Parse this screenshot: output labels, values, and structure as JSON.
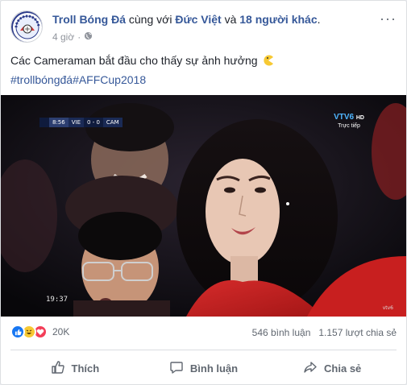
{
  "post": {
    "page_name": "Troll Bóng Đá",
    "with_text": " cùng với ",
    "tagged_person": "Đức Việt",
    "and_text": " và ",
    "others": "18 người khác",
    "period": ".",
    "time": "4 giờ",
    "dot": "·",
    "text": "Các Cameraman bắt đầu cho thấy sự ảnh hưởng",
    "hashtag1": "#trollbóngđá",
    "hashtag2": "#AFFCup2018",
    "more_label": "···"
  },
  "video": {
    "time_score": "8:56",
    "team_home": "VIE",
    "score": "0 - 0",
    "team_away": "CAM",
    "channel": "VTV6",
    "channel_hd": "HD",
    "live_label": "Trực tiếp",
    "timecode": "19:37",
    "watermark": "vtv6"
  },
  "stats": {
    "reaction_count": "20K",
    "comments": "546 bình luận",
    "shares": "1.157 lượt chia sẻ"
  },
  "actions": {
    "like": "Thích",
    "comment": "Bình luận",
    "share": "Chia sẻ"
  },
  "colors": {
    "link": "#365899",
    "like_blue": "#1877f2",
    "love_red": "#f33e58",
    "haha_yellow": "#f7c933"
  },
  "icons": {
    "globe": "globe-icon",
    "like": "thumbs-up-icon",
    "comment": "comment-bubble-icon",
    "share": "share-arrow-icon",
    "emoji": "pacman-emoji-icon"
  }
}
